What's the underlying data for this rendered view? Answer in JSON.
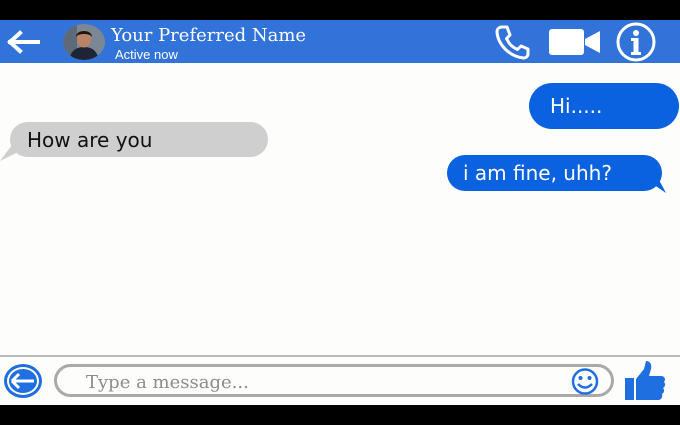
{
  "header": {
    "contact_name": "Your Preferred Name",
    "status": "Active now",
    "color": "#3173d8"
  },
  "icons": {
    "back": "back-arrow-icon",
    "call": "phone-icon",
    "video": "video-camera-icon",
    "info": "info-icon",
    "emoji": "smiley-icon",
    "like": "thumbs-up-icon"
  },
  "messages": [
    {
      "direction": "outgoing",
      "text": "Hi....."
    },
    {
      "direction": "incoming",
      "text": "How are you"
    },
    {
      "direction": "outgoing",
      "text": "i am fine, uhh?"
    }
  ],
  "composer": {
    "placeholder": "Type a message..."
  },
  "colors": {
    "outgoing_bubble": "#0b62e0",
    "incoming_bubble": "#cfcfcf",
    "accent": "#1f6fe0"
  }
}
